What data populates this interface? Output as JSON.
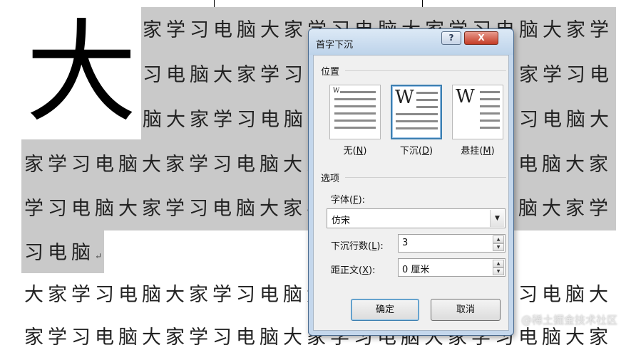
{
  "document": {
    "drop_cap": "大",
    "lines": [
      "家学习电脑大家学习电脑大家学习电脑大家学",
      "习电脑大家学习电脑大家学习电脑大家学习电",
      "脑大家学习电脑大家学习电脑大家学习电脑大",
      "家学习电脑大家学习电脑大家学习电脑大家学习电脑大家",
      "学习电脑大家学习电脑大家学习电脑大家学习电脑大家学",
      "习电脑",
      "大家学习电脑大家学习电脑大家学习电脑大家学习电脑大",
      "家学习电脑大家学习电脑大家学习电脑大家学习电脑大家"
    ],
    "paragraph_mark": "↵",
    "watermark": "@稀土掘金技术社区"
  },
  "dialog": {
    "title": "首字下沉",
    "help_label": "?",
    "close_label": "X",
    "position_group": "位置",
    "options": [
      {
        "label": "无",
        "key": "N"
      },
      {
        "label": "下沉",
        "key": "D"
      },
      {
        "label": "悬挂",
        "key": "M"
      }
    ],
    "selected_option": "下沉",
    "preview_glyph": "W",
    "options_group": "选项",
    "font_label": "字体",
    "font_key": "F",
    "font_value": "仿宋",
    "lines_label": "下沉行数",
    "lines_key": "L",
    "lines_value": "3",
    "distance_label": "距正文",
    "distance_key": "X",
    "distance_value": "0 厘米",
    "ok_label": "确定",
    "cancel_label": "取消"
  }
}
